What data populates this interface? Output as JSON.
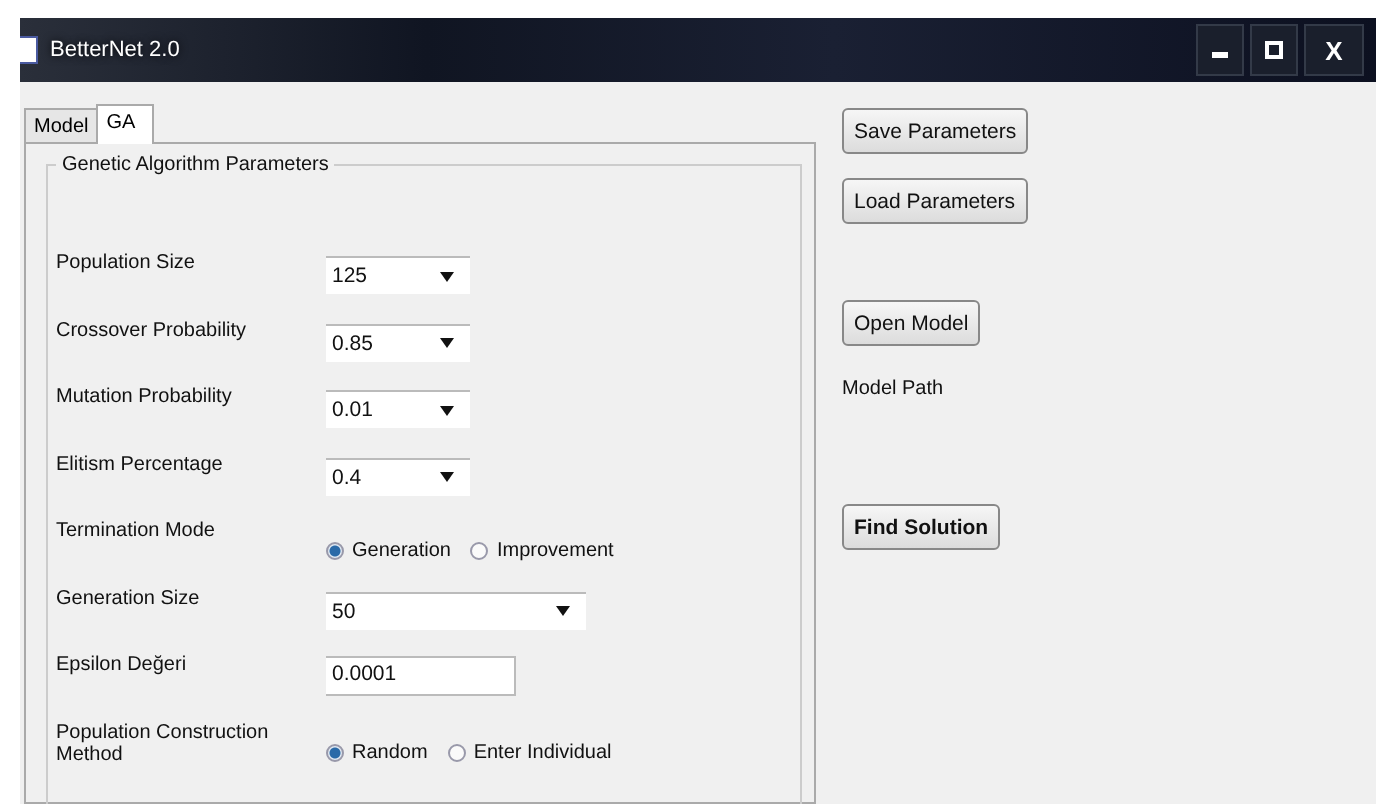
{
  "window": {
    "title": "BetterNet 2.0",
    "close": "X"
  },
  "tabs": [
    {
      "label": "Model",
      "selected": false
    },
    {
      "label": "GA",
      "selected": true
    }
  ],
  "group": {
    "title": "Genetic Algorithm Parameters"
  },
  "fields": [
    {
      "kind": "combo",
      "label": "Population Size",
      "value": "125"
    },
    {
      "kind": "combo",
      "label": "Crossover Probability",
      "value": "0.85"
    },
    {
      "kind": "combo",
      "label": "Mutation Probability",
      "value": "0.01"
    },
    {
      "kind": "combo",
      "label": "Elitism Percentage",
      "value": "0.4"
    },
    {
      "kind": "radio",
      "label": "Termination Mode",
      "options": [
        {
          "label": "Generation",
          "selected": true
        },
        {
          "label": "Improvement",
          "selected": false
        }
      ]
    },
    {
      "kind": "wide_combo",
      "label": "Generation Size",
      "value": "50"
    },
    {
      "kind": "text",
      "label": "Epsilon Değeri",
      "value": "0.0001"
    },
    {
      "kind": "radio",
      "label": "Population Construction Method",
      "options": [
        {
          "label": "Random",
          "selected": true
        },
        {
          "label": "Enter Individual",
          "selected": false
        }
      ]
    }
  ],
  "side": [
    {
      "kind": "button",
      "text": "Save Parameters",
      "bold": false
    },
    {
      "kind": "button",
      "text": "Load Parameters",
      "bold": false
    },
    {
      "kind": "button",
      "text": "Open Model",
      "bold": false
    },
    {
      "kind": "label",
      "text": "Model Path"
    },
    {
      "kind": "button",
      "text": "Find Solution",
      "bold": true
    }
  ]
}
